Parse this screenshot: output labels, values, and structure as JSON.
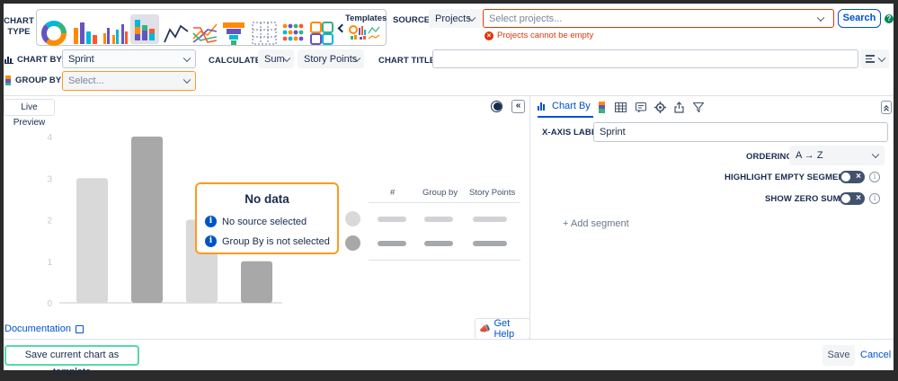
{
  "chart_type": {
    "label_line1": "CHART",
    "label_line2": "TYPE",
    "templates_label": "Templates",
    "types": [
      "donut-chart-icon",
      "bar-chart-icon",
      "grouped-bar-chart-icon",
      "stacked-bar-chart-icon",
      "line-chart-icon",
      "multi-line-chart-icon",
      "funnel-chart-icon",
      "table-chart-icon",
      "dot-matrix-chart-icon",
      "tile-chart-icon"
    ]
  },
  "source": {
    "label": "SOURCE",
    "type_value": "Projects",
    "placeholder": "Select projects...",
    "error": "Projects cannot be empty",
    "search_label": "Search",
    "help_symbol": "?"
  },
  "config": {
    "chart_by_label": "CHART BY",
    "chart_by_value": "Sprint",
    "calculate_label": "CALCULATE",
    "calc_function": "Sum",
    "calc_field": "Story Points",
    "chart_title_label": "CHART TITLE",
    "chart_title_value": "",
    "group_by_label": "GROUP BY",
    "group_by_placeholder": "Select..."
  },
  "preview": {
    "tab_label": "Live Preview",
    "collapse_symbol": "«",
    "y_ticks": [
      "0",
      "1",
      "2",
      "3",
      "4"
    ],
    "no_data_title": "No data",
    "no_data_messages": [
      "No source selected",
      "Group By is not selected"
    ],
    "legend_headers": [
      "#",
      "Group by",
      "Story Points"
    ],
    "documentation_label": "Documentation",
    "get_help_label": "Get Help"
  },
  "chart_data": {
    "type": "bar",
    "title": "",
    "categories": [
      "",
      "",
      "",
      ""
    ],
    "values": [
      3,
      4,
      2,
      1
    ],
    "ylim": [
      0,
      4
    ],
    "grid": false,
    "colors": [
      "#d9d9d9",
      "#a8a8a8",
      "#d9d9d9",
      "#a8a8a8"
    ]
  },
  "right_panel": {
    "tab_chart_by": "Chart By",
    "x_axis_label": "X-AXIS LABEL",
    "x_axis_value": "Sprint",
    "ordering_label": "ORDERING",
    "ordering_value": "A → Z",
    "highlight_label": "HIGHLIGHT EMPTY SEGMENTS",
    "show_zero_label": "SHOW ZERO SUMS",
    "add_segment_label": "+ Add segment",
    "expand_symbol": "«"
  },
  "footer": {
    "save_template_label": "Save current chart as template",
    "save_label": "Save",
    "cancel_label": "Cancel"
  },
  "colors": {
    "accent": "#0052cc",
    "error": "#de350b",
    "warning": "#ff991f",
    "success": "#36b37e",
    "template_border": "#57d9a3"
  }
}
